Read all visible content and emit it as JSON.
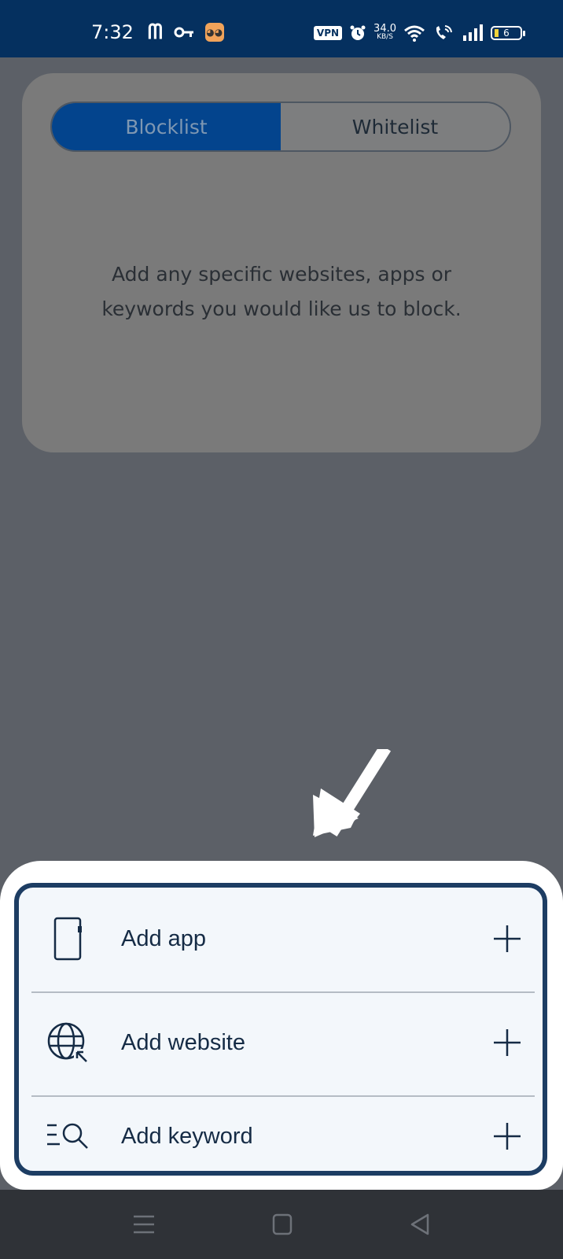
{
  "status_bar": {
    "time": "7:32",
    "left_icons": [
      "m-app-icon",
      "key-icon",
      "owl-app-icon"
    ],
    "vpn_label": "VPN",
    "net_speed_value": "34.0",
    "net_speed_unit": "KB/S",
    "battery_level": "6",
    "colors": {
      "background": "#05305f"
    }
  },
  "main": {
    "tabs": [
      {
        "label": "Blocklist",
        "active": true
      },
      {
        "label": "Whitelist",
        "active": false
      }
    ],
    "empty_message": "Add any specific websites, apps or keywords you would like us to block."
  },
  "sheet": {
    "items": [
      {
        "label": "Add app",
        "icon": "phone-icon"
      },
      {
        "label": "Add website",
        "icon": "globe-icon"
      },
      {
        "label": "Add keyword",
        "icon": "keyword-search-icon"
      }
    ]
  },
  "colors": {
    "accent": "#03448d",
    "sheet_border": "#1d3d63",
    "overlay": "#5c6067"
  }
}
